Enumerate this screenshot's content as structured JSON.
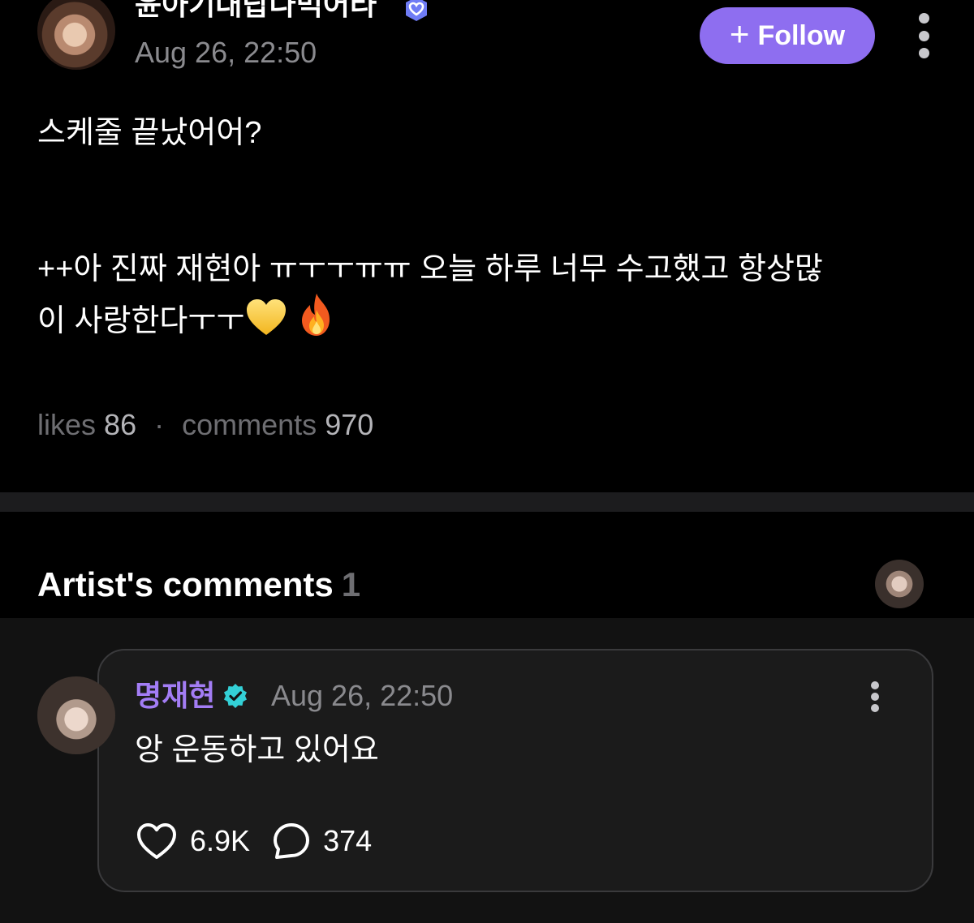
{
  "post": {
    "author_name": "윤아기대랍나먹어라",
    "date": "Aug 26, 22:50",
    "follow_label": "Follow",
    "text": "스케줄 끝났어어?\n\n\n++아 진짜 재현아 ㅠㅜㅜㅠㅠ 오늘 하루 너무 수고했고 항상많\n이 사랑한다ㅜㅜ",
    "stats": {
      "likes_label": "likes",
      "likes_value": "86",
      "separator": "·",
      "comments_label": "comments",
      "comments_value": "970"
    },
    "emojis": [
      "yellow-heart-icon",
      "fire-icon"
    ]
  },
  "artist_comments": {
    "title": "Artist's comments",
    "count": "1"
  },
  "comment": {
    "author": "명재현",
    "date": "Aug 26, 22:50",
    "text": "앙 운동하고 있어요",
    "likes": "6.9K",
    "replies": "374"
  },
  "colors": {
    "background": "#000000",
    "accent_purple": "#8e6ef0",
    "artist_name": "#a37df5",
    "verified": "#33d0d6",
    "muted_text": "#8a8a8e",
    "card_background": "#1b1b1b",
    "card_border": "#3a3a3c"
  },
  "icons": [
    "fan-badge-icon",
    "plus-icon",
    "more-vertical-icon",
    "verified-icon",
    "heart-icon",
    "comment-bubble-icon"
  ]
}
